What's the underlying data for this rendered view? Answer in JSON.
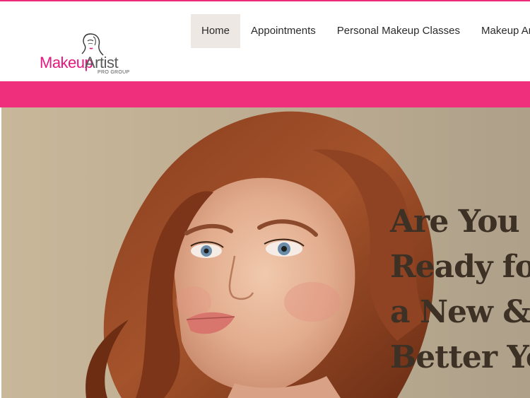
{
  "brand": {
    "name_part1": "Makeup",
    "name_part2": "Artist",
    "subtitle": "PRO GROUP",
    "accent_color": "#ee2a7b"
  },
  "nav": {
    "items": [
      {
        "label": "Home",
        "active": true
      },
      {
        "label": "Appointments",
        "active": false
      },
      {
        "label": "Personal Makeup Classes",
        "active": false
      },
      {
        "label": "Makeup Artist",
        "active": false
      }
    ]
  },
  "hero": {
    "heading_lines": [
      "Are You",
      "Ready for",
      "a New &",
      "Better You"
    ],
    "image_icon": "model-portrait-photo"
  }
}
